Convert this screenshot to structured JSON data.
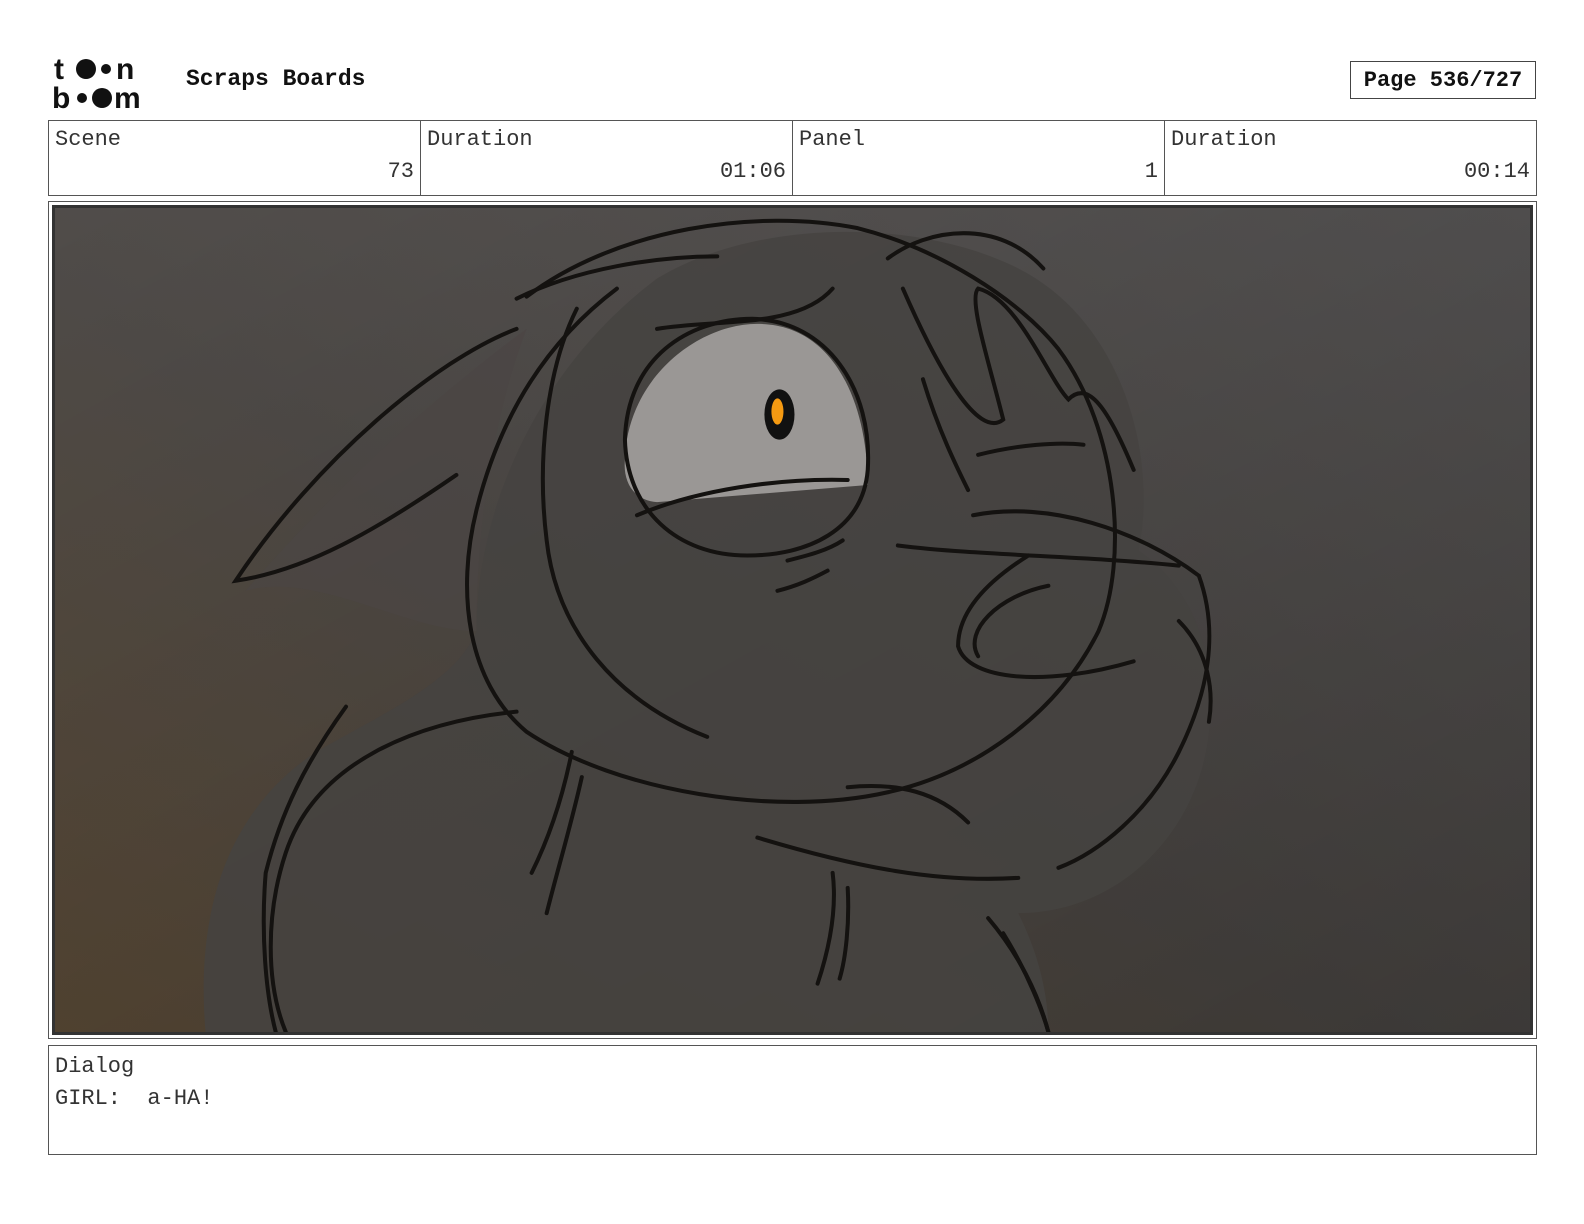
{
  "header": {
    "logo_text": "toon boom",
    "project_title": "Scraps Boards",
    "page_label": "Page 536/727"
  },
  "info": {
    "scene_label": "Scene",
    "scene_value": "73",
    "scene_duration_label": "Duration",
    "scene_duration_value": "01:06",
    "panel_label": "Panel",
    "panel_value": "1",
    "panel_duration_label": "Duration",
    "panel_duration_value": "00:14"
  },
  "panel": {
    "background_colors": [
      "#5a4a38",
      "#4e4b49",
      "#3a3a3a"
    ],
    "eye_iris_color": "#f59a12"
  },
  "dialog": {
    "label": "Dialog",
    "text": "GIRL:  a-HA!"
  }
}
